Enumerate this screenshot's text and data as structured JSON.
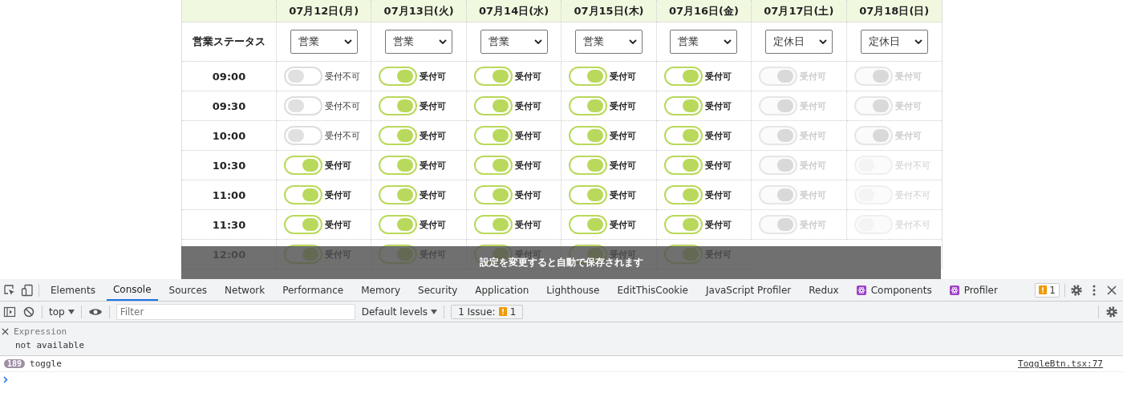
{
  "schedule": {
    "days": [
      {
        "label": "07月12日(月)",
        "status": "営業"
      },
      {
        "label": "07月13日(火)",
        "status": "営業"
      },
      {
        "label": "07月14日(水)",
        "status": "営業"
      },
      {
        "label": "07月15日(木)",
        "status": "営業"
      },
      {
        "label": "07月16日(金)",
        "status": "営業"
      },
      {
        "label": "07月17日(土)",
        "status": "定休日"
      },
      {
        "label": "07月18日(日)",
        "status": "定休日"
      }
    ],
    "status_label": "営業ステータス",
    "rows": [
      {
        "time": "09:00",
        "cells": [
          {
            "on": false,
            "disabled": false,
            "label": "受付不可"
          },
          {
            "on": true,
            "disabled": false,
            "label": "受付可"
          },
          {
            "on": true,
            "disabled": false,
            "label": "受付可"
          },
          {
            "on": true,
            "disabled": false,
            "label": "受付可"
          },
          {
            "on": true,
            "disabled": false,
            "label": "受付可"
          },
          {
            "on": true,
            "disabled": true,
            "label": "受付可"
          },
          {
            "on": true,
            "disabled": true,
            "label": "受付可"
          }
        ]
      },
      {
        "time": "09:30",
        "cells": [
          {
            "on": false,
            "disabled": false,
            "label": "受付不可"
          },
          {
            "on": true,
            "disabled": false,
            "label": "受付可"
          },
          {
            "on": true,
            "disabled": false,
            "label": "受付可"
          },
          {
            "on": true,
            "disabled": false,
            "label": "受付可"
          },
          {
            "on": true,
            "disabled": false,
            "label": "受付可"
          },
          {
            "on": true,
            "disabled": true,
            "label": "受付可"
          },
          {
            "on": true,
            "disabled": true,
            "label": "受付可"
          }
        ]
      },
      {
        "time": "10:00",
        "cells": [
          {
            "on": false,
            "disabled": false,
            "label": "受付不可"
          },
          {
            "on": true,
            "disabled": false,
            "label": "受付可"
          },
          {
            "on": true,
            "disabled": false,
            "label": "受付可"
          },
          {
            "on": true,
            "disabled": false,
            "label": "受付可"
          },
          {
            "on": true,
            "disabled": false,
            "label": "受付可"
          },
          {
            "on": true,
            "disabled": true,
            "label": "受付可"
          },
          {
            "on": true,
            "disabled": true,
            "label": "受付可"
          }
        ]
      },
      {
        "time": "10:30",
        "cells": [
          {
            "on": true,
            "disabled": false,
            "label": "受付可"
          },
          {
            "on": true,
            "disabled": false,
            "label": "受付可"
          },
          {
            "on": true,
            "disabled": false,
            "label": "受付可"
          },
          {
            "on": true,
            "disabled": false,
            "label": "受付可"
          },
          {
            "on": true,
            "disabled": false,
            "label": "受付可"
          },
          {
            "on": true,
            "disabled": true,
            "label": "受付可"
          },
          {
            "on": false,
            "disabled": true,
            "label": "受付不可"
          }
        ]
      },
      {
        "time": "11:00",
        "cells": [
          {
            "on": true,
            "disabled": false,
            "label": "受付可"
          },
          {
            "on": true,
            "disabled": false,
            "label": "受付可"
          },
          {
            "on": true,
            "disabled": false,
            "label": "受付可"
          },
          {
            "on": true,
            "disabled": false,
            "label": "受付可"
          },
          {
            "on": true,
            "disabled": false,
            "label": "受付可"
          },
          {
            "on": true,
            "disabled": true,
            "label": "受付可"
          },
          {
            "on": false,
            "disabled": true,
            "label": "受付不可"
          }
        ]
      },
      {
        "time": "11:30",
        "cells": [
          {
            "on": true,
            "disabled": false,
            "label": "受付可"
          },
          {
            "on": true,
            "disabled": false,
            "label": "受付可"
          },
          {
            "on": true,
            "disabled": false,
            "label": "受付可"
          },
          {
            "on": true,
            "disabled": false,
            "label": "受付可"
          },
          {
            "on": true,
            "disabled": false,
            "label": "受付可"
          },
          {
            "on": true,
            "disabled": true,
            "label": "受付可"
          },
          {
            "on": false,
            "disabled": true,
            "label": "受付不可"
          }
        ]
      },
      {
        "time": "12:00",
        "cells": [
          {
            "on": true,
            "disabled": false,
            "label": "受付可"
          },
          {
            "on": true,
            "disabled": false,
            "label": "受付可"
          },
          {
            "on": true,
            "disabled": false,
            "label": "受付可"
          },
          {
            "on": true,
            "disabled": false,
            "label": "受付可"
          },
          {
            "on": true,
            "disabled": false,
            "label": "受付可"
          }
        ]
      }
    ]
  },
  "toast": {
    "message": "設定を変更すると自動で保存されます"
  },
  "devtools": {
    "tabs": [
      {
        "label": "Elements",
        "selected": false
      },
      {
        "label": "Console",
        "selected": true
      },
      {
        "label": "Sources",
        "selected": false
      },
      {
        "label": "Network",
        "selected": false
      },
      {
        "label": "Performance",
        "selected": false
      },
      {
        "label": "Memory",
        "selected": false
      },
      {
        "label": "Security",
        "selected": false
      },
      {
        "label": "Application",
        "selected": false
      },
      {
        "label": "Lighthouse",
        "selected": false
      },
      {
        "label": "EditThisCookie",
        "selected": false
      },
      {
        "label": "JavaScript Profiler",
        "selected": false
      },
      {
        "label": "Redux",
        "selected": false
      },
      {
        "label": "Components",
        "selected": false,
        "kind": "react"
      },
      {
        "label": "Profiler",
        "selected": false,
        "kind": "react"
      }
    ],
    "issues_count": "1",
    "context": "top",
    "filter": {
      "placeholder": "Filter"
    },
    "levels": "Default levels",
    "issue_badge": {
      "label": "1 Issue:",
      "count": "1"
    },
    "expression": {
      "title": "Expression",
      "value": "not available"
    },
    "messages": [
      {
        "count": "189",
        "text": "toggle",
        "source": "ToggleBtn.tsx:77"
      }
    ]
  }
}
